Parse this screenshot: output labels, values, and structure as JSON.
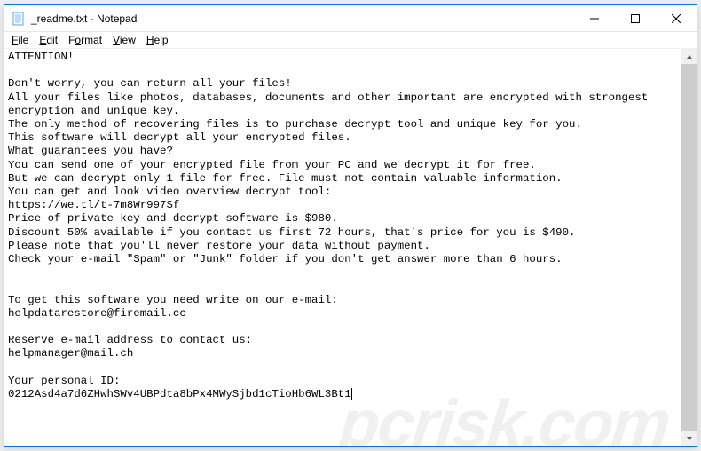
{
  "window": {
    "title": "_readme.txt - Notepad"
  },
  "menu": {
    "file": "File",
    "edit": "Edit",
    "format": "Format",
    "view": "View",
    "help": "Help"
  },
  "body": {
    "l1": "ATTENTION!",
    "l2": "",
    "l3": "Don't worry, you can return all your files!",
    "l4": "All your files like photos, databases, documents and other important are encrypted with strongest encryption and unique key.",
    "l5": "The only method of recovering files is to purchase decrypt tool and unique key for you.",
    "l6": "This software will decrypt all your encrypted files.",
    "l7": "What guarantees you have?",
    "l8": "You can send one of your encrypted file from your PC and we decrypt it for free.",
    "l9": "But we can decrypt only 1 file for free. File must not contain valuable information.",
    "l10": "You can get and look video overview decrypt tool:",
    "l11": "https://we.tl/t-7m8Wr997Sf",
    "l12": "Price of private key and decrypt software is $980.",
    "l13": "Discount 50% available if you contact us first 72 hours, that's price for you is $490.",
    "l14": "Please note that you'll never restore your data without payment.",
    "l15": "Check your e-mail \"Spam\" or \"Junk\" folder if you don't get answer more than 6 hours.",
    "l16": "",
    "l17": "",
    "l18": "To get this software you need write on our e-mail:",
    "l19": "helpdatarestore@firemail.cc",
    "l20": "",
    "l21": "Reserve e-mail address to contact us:",
    "l22": "helpmanager@mail.ch",
    "l23": "",
    "l24": "Your personal ID:",
    "l25": "0212Asd4a7d6ZHwhSWv4UBPdta8bPx4MWySjbd1cTioHb6WL3Bt1"
  },
  "watermark": "pcrisk.com"
}
